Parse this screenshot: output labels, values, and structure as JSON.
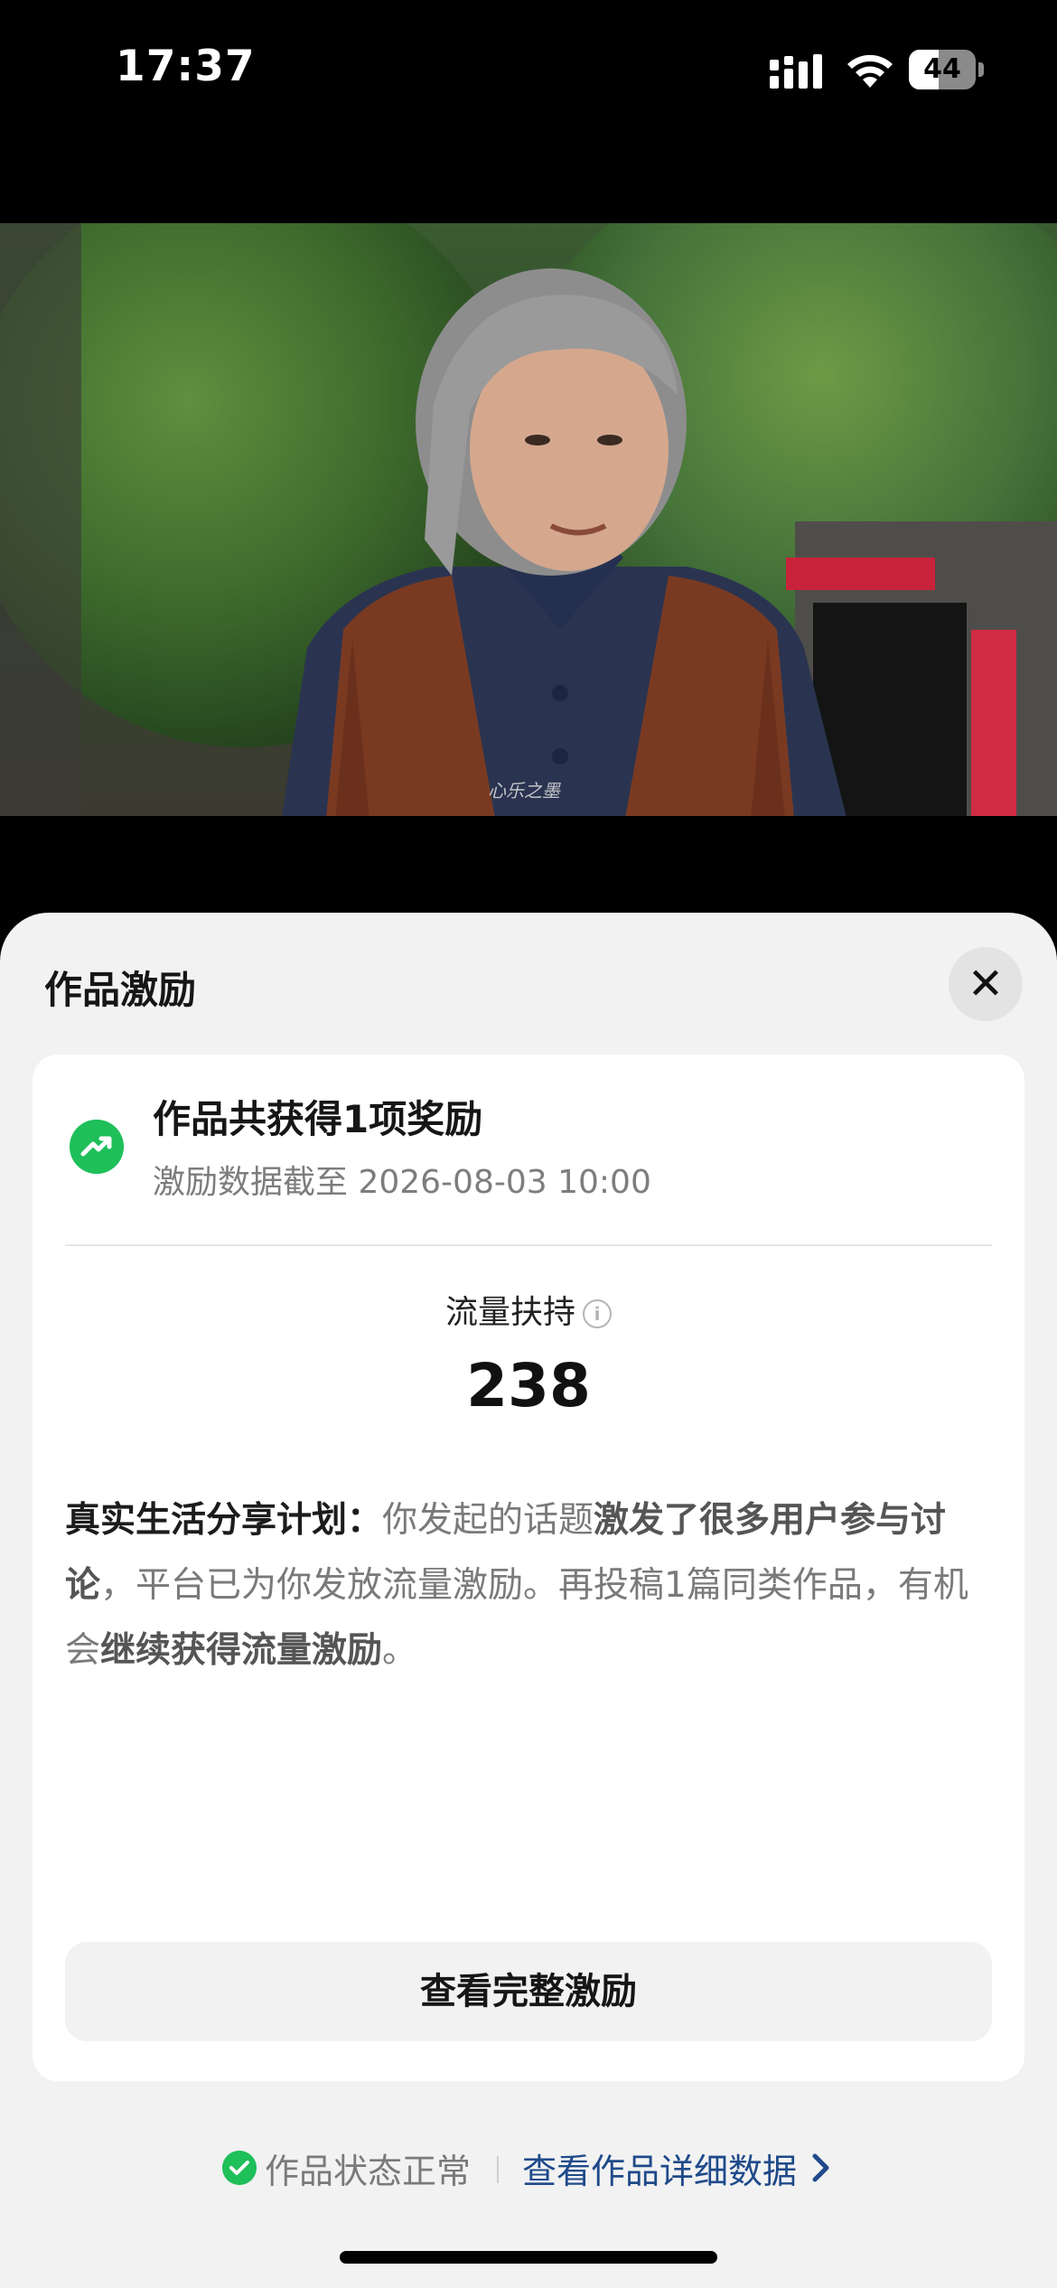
{
  "status_bar": {
    "time": "17:37",
    "battery": "44",
    "battery_level": 0.44
  },
  "video": {
    "watermark": "心乐之墨"
  },
  "sheet": {
    "title": "作品激励",
    "close_label": "✕",
    "card": {
      "heading": "作品共获得1项奖励",
      "subtitle": "激励数据截至 2026-08-03 10:00",
      "metric_label": "流量扶持",
      "info_symbol": "i",
      "metric_value": "238",
      "desc": {
        "plan": "真实生活分享计划：",
        "part1": "你发起的话题",
        "highlight1": "激发了很多用户参与讨论",
        "part2": "，平台已为你发放流量激励。再投稿1篇同类作品，有机会",
        "highlight2": "继续获得流量激励",
        "part3": "。"
      },
      "button": "查看完整激励"
    },
    "footer": {
      "status": "作品状态正常",
      "link": "查看作品详细数据"
    }
  },
  "colors": {
    "accent_green": "#1fbf5a",
    "link_blue": "#1f4a8a"
  }
}
